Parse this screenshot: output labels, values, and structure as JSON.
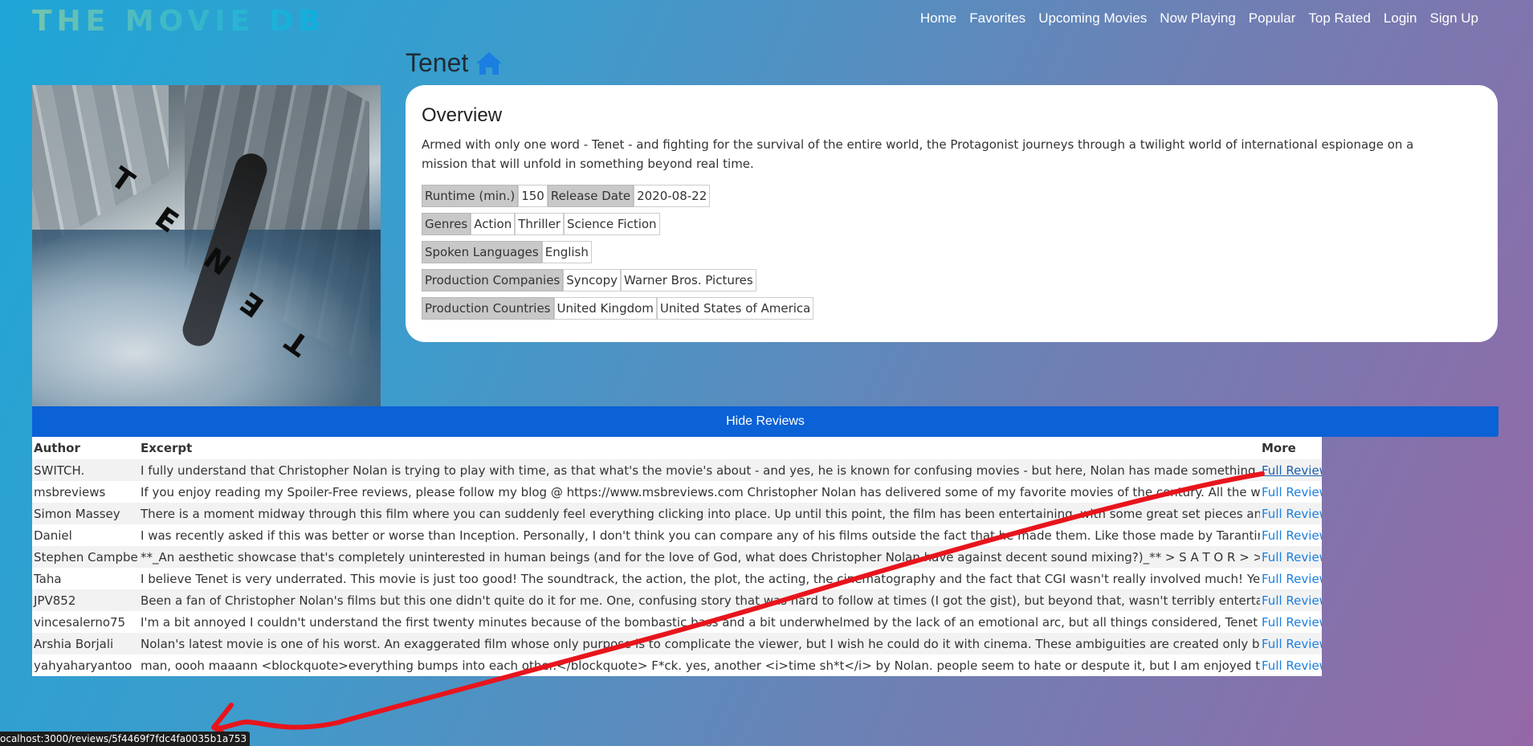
{
  "brand": "THE MOVIE DB",
  "nav": [
    "Home",
    "Favorites",
    "Upcoming Movies",
    "Now Playing",
    "Popular",
    "Top Rated",
    "Login",
    "Sign Up"
  ],
  "movie": {
    "title": "Tenet",
    "overview_heading": "Overview",
    "overview": "Armed with only one word - Tenet - and fighting for the survival of the entire world, the Protagonist journeys through a twilight world of international espionage on a mission that will unfold in something beyond real time.",
    "runtime_label": "Runtime (min.)",
    "runtime": "150",
    "release_label": "Release Date",
    "release_date": "2020-08-22",
    "genres_label": "Genres",
    "genres": [
      "Action",
      "Thriller",
      "Science Fiction"
    ],
    "languages_label": "Spoken Languages",
    "languages": [
      "English"
    ],
    "companies_label": "Production Companies",
    "companies": [
      "Syncopy",
      "Warner Bros. Pictures"
    ],
    "countries_label": "Production Countries",
    "countries": [
      "United Kingdom",
      "United States of America"
    ]
  },
  "reviews": {
    "toggle_label": "Hide Reviews",
    "headers": {
      "author": "Author",
      "excerpt": "Excerpt",
      "more": "More"
    },
    "link_label": "Full Review",
    "rows": [
      {
        "author": "SWITCH.",
        "excerpt": "I fully understand that Christopher Nolan is trying to play with time, as that what's the movie's about - and yes, he is known for confusing movies - but here, Nolan has made something..."
      },
      {
        "author": "msbreviews",
        "excerpt": "If you enjoy reading my Spoiler-Free reviews, please follow my blog @ https://www.msbreviews.com Christopher Nolan has delivered some of my favorite movies of the century. All the way from..."
      },
      {
        "author": "Simon Massey",
        "excerpt": "There is a moment midway through this film where you can suddenly feel everything clicking into place. Up until this point, the film has been entertaining, with some great set pieces and a scope..."
      },
      {
        "author": "Daniel",
        "excerpt": "I was recently asked if this was better or worse than Inception. Personally, I don't think you can compare any of his films outside the fact that he made them. Like those made by Tarantino, each..."
      },
      {
        "author": "Stephen Campbell",
        "excerpt": "**_An aesthetic showcase that's completely uninterested in human beings (and for the love of God, what does Christopher Nolan have against decent sound mixing?)_** > S A T O R > > A R E P..."
      },
      {
        "author": "Taha",
        "excerpt": "I believe Tenet is very underrated. This movie is just too good! The soundtrack, the action, the plot, the acting, the cinematography and the fact that CGI wasn't really involved much! Yet it..."
      },
      {
        "author": "JPV852",
        "excerpt": "Been a fan of Christopher Nolan's films but this one didn't quite do it for me. One, confusing story that was hard to follow at times (I got the gist), but beyond that, wasn't terribly entertained...."
      },
      {
        "author": "vincesalerno75",
        "excerpt": "I'm a bit annoyed I couldn't understand the first twenty minutes because of the bombastic bass and a bit underwhelmed by the lack of an emotional arc, but all things considered, Tenet is an epic..."
      },
      {
        "author": "Arshia Borjali",
        "excerpt": "Nolan's latest movie is one of his worst. An exaggerated film whose only purpose is to complicate the viewer, but I wish he could do it with cinema. These ambiguities are created only by the..."
      },
      {
        "author": "yahyaharyantoo",
        "excerpt": "man, oooh maaann <blockquote>everything bumps into each other.</blockquote> F*ck. yes, another <i>time sh*t</i> by Nolan. people seem to hate or despute it, but I am enjoyed the film. the..."
      }
    ]
  },
  "status_url": "ocalhost:3000/reviews/5f4469f7fdc4fa0035b1a753",
  "colors": {
    "accent": "#0b61d6",
    "link": "#1a7fe0",
    "annotation": "#e8141c"
  }
}
